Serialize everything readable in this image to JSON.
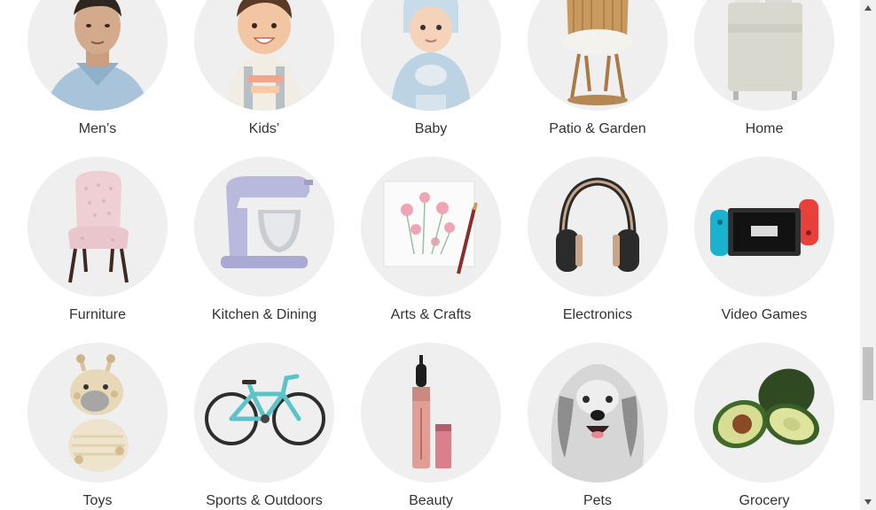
{
  "categories": [
    {
      "label": "Men’s",
      "icon": "mens-icon"
    },
    {
      "label": "Kids’",
      "icon": "kids-icon"
    },
    {
      "label": "Baby",
      "icon": "baby-icon"
    },
    {
      "label": "Patio & Garden",
      "icon": "patio-chair-icon"
    },
    {
      "label": "Home",
      "icon": "bedding-icon"
    },
    {
      "label": "Furniture",
      "icon": "chair-icon"
    },
    {
      "label": "Kitchen & Dining",
      "icon": "stand-mixer-icon"
    },
    {
      "label": "Arts & Crafts",
      "icon": "painting-icon"
    },
    {
      "label": "Electronics",
      "icon": "headphones-icon"
    },
    {
      "label": "Video Games",
      "icon": "game-console-icon"
    },
    {
      "label": "Toys",
      "icon": "giraffe-plush-icon"
    },
    {
      "label": "Sports & Outdoors",
      "icon": "bicycle-icon"
    },
    {
      "label": "Beauty",
      "icon": "mascara-icon"
    },
    {
      "label": "Pets",
      "icon": "dog-icon"
    },
    {
      "label": "Grocery",
      "icon": "avocado-icon"
    }
  ],
  "colors": {
    "circle_bg": "#efefef",
    "label": "#333333",
    "scrollbar_track": "#f1f1f1",
    "scrollbar_thumb": "#c1c1c1"
  }
}
